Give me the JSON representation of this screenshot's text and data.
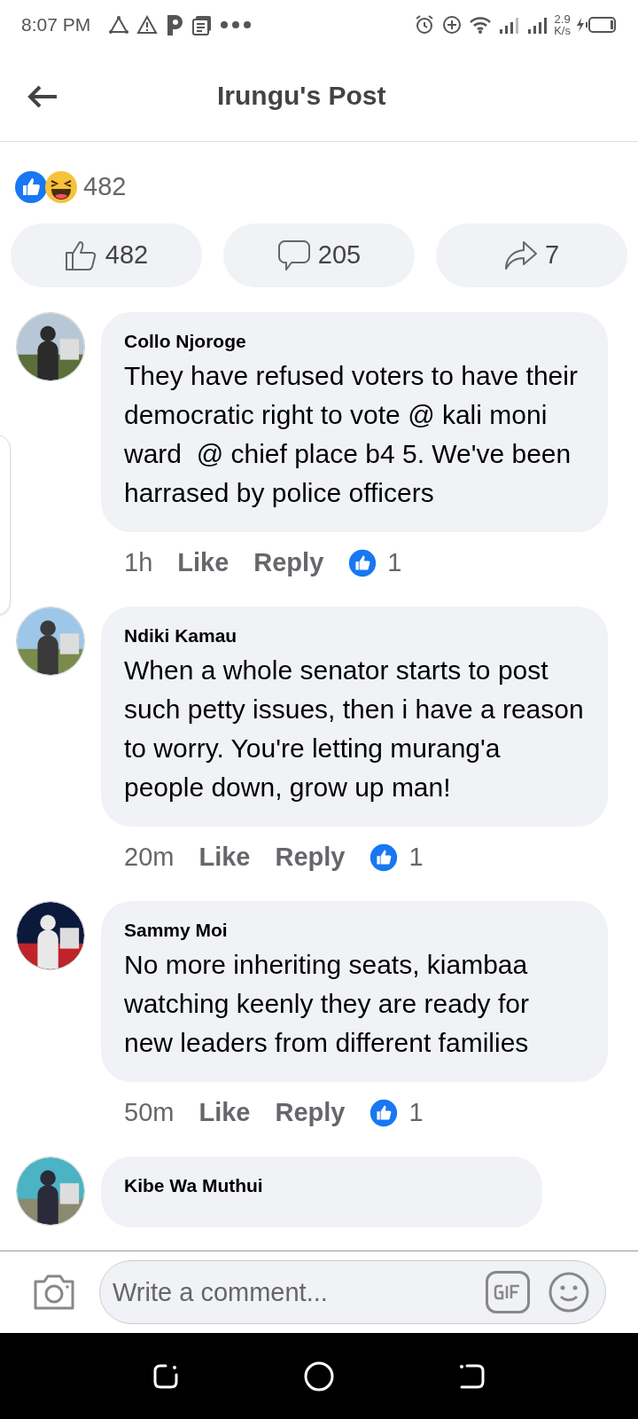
{
  "status_bar": {
    "time": "8:07 PM",
    "speed_value": "2.9",
    "speed_unit": "K/s"
  },
  "header": {
    "title": "Irungu's Post"
  },
  "post": {
    "reaction_count": "482",
    "actions": [
      {
        "kind": "like",
        "count": "482"
      },
      {
        "kind": "comment",
        "count": "205"
      },
      {
        "kind": "share",
        "count": "7"
      }
    ]
  },
  "comments": [
    {
      "author": "Collo Njoroge",
      "text": "They have refused voters to have their  democratic right to vote @ kali moni ward  @ chief place b4 5. We've been harrased by police officers",
      "time": "1h",
      "like_label": "Like",
      "reply_label": "Reply",
      "likes": "1"
    },
    {
      "author": "Ndiki Kamau",
      "text": "When a whole senator starts to post such petty issues, then i have a reason to worry. You're letting murang'a people down, grow up man!",
      "time": "20m",
      "like_label": "Like",
      "reply_label": "Reply",
      "likes": "1"
    },
    {
      "author": "Sammy Moi",
      "text": "No more inheriting seats, kiambaa watching keenly they are ready for new leaders from different families",
      "time": "50m",
      "like_label": "Like",
      "reply_label": "Reply",
      "likes": "1"
    },
    {
      "author": "Kibe Wa Muthui"
    }
  ],
  "composer": {
    "placeholder": "Write a comment..."
  }
}
